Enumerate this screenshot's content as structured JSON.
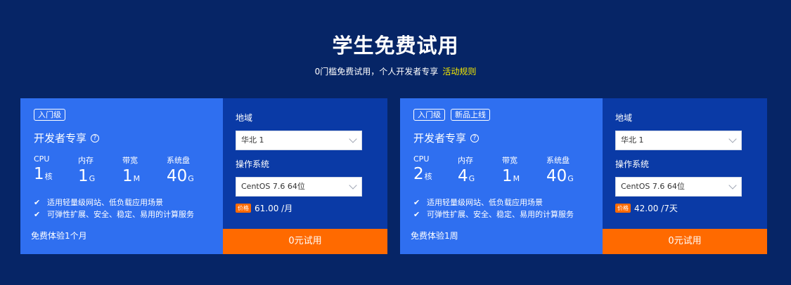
{
  "header": {
    "title": "学生免费试用",
    "subtitle": "0门槛免费试用，个人开发者专享",
    "rules_link": "活动规则"
  },
  "colors": {
    "background": "#062566",
    "card_left": "#2f6ff0",
    "card_right": "#0a3aa6",
    "accent_orange": "#ff6a00",
    "link_yellow": "#f5e900"
  },
  "cards": [
    {
      "tags": [
        "入门级"
      ],
      "plan_title": "开发者专享",
      "help_icon": "question-circle-icon",
      "specs": {
        "cpu": {
          "label": "CPU",
          "value": "1",
          "unit": "核"
        },
        "memory": {
          "label": "内存",
          "value": "1",
          "unit": "G"
        },
        "bandwidth": {
          "label": "带宽",
          "value": "1",
          "unit": "M"
        },
        "disk": {
          "label": "系统盘",
          "value": "40",
          "unit": "G"
        }
      },
      "features": [
        "适用轻量级网站、低负载应用场景",
        "可弹性扩展、安全、稳定、易用的计算服务"
      ],
      "trial_text": "免费体验1个月",
      "region_label": "地域",
      "region_value": "华北 1",
      "os_label": "操作系统",
      "os_value": "CentOS 7.6 64位",
      "price_badge": "价格",
      "price": "61.00 /月",
      "button": "0元试用"
    },
    {
      "tags": [
        "入门级",
        "新品上线"
      ],
      "plan_title": "开发者专享",
      "help_icon": "question-circle-icon",
      "specs": {
        "cpu": {
          "label": "CPU",
          "value": "2",
          "unit": "核"
        },
        "memory": {
          "label": "内存",
          "value": "4",
          "unit": "G"
        },
        "bandwidth": {
          "label": "带宽",
          "value": "1",
          "unit": "M"
        },
        "disk": {
          "label": "系统盘",
          "value": "40",
          "unit": "G"
        }
      },
      "features": [
        "适用轻量级网站、低负载应用场景",
        "可弹性扩展、安全、稳定、易用的计算服务"
      ],
      "trial_text": "免费体验1周",
      "region_label": "地域",
      "region_value": "华北 1",
      "os_label": "操作系统",
      "os_value": "CentOS 7.6 64位",
      "price_badge": "价格",
      "price": "42.00 /7天",
      "button": "0元试用"
    }
  ]
}
